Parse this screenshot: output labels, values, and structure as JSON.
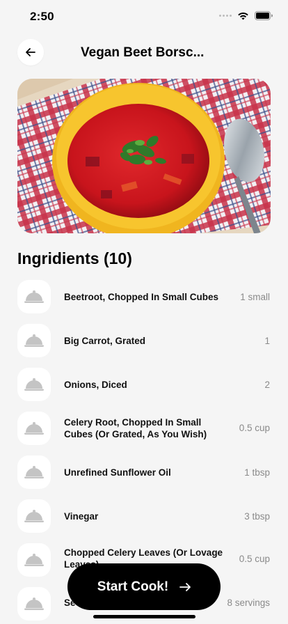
{
  "status_bar": {
    "time": "2:50"
  },
  "header": {
    "title": "Vegan Beet Borsc..."
  },
  "hero_image": {
    "alt": "Vegan Beet Borscht"
  },
  "ingredients": {
    "title": "Ingridients (10)",
    "items": [
      {
        "name": "Beetroot, Chopped In Small Cubes",
        "qty": "1 small"
      },
      {
        "name": "Big Carrot, Grated",
        "qty": "1"
      },
      {
        "name": "Onions, Diced",
        "qty": "2"
      },
      {
        "name": "Celery Root, Chopped In Small Cubes (Or Grated, As You Wish)",
        "qty": "0.5 cup"
      },
      {
        "name": "Unrefined Sunflower Oil",
        "qty": "1 tbsp"
      },
      {
        "name": "Vinegar",
        "qty": "3 tbsp"
      },
      {
        "name": "Chopped Celery Leaves (Or Lovage Leaves)",
        "qty": "0.5 cup"
      },
      {
        "name": "Se",
        "qty": "8 servings"
      }
    ]
  },
  "cta": {
    "label": "Start Cook!"
  },
  "icons": {
    "back": "arrow-left-icon",
    "ingredient": "cloche-icon",
    "cta": "arrow-right-icon"
  }
}
